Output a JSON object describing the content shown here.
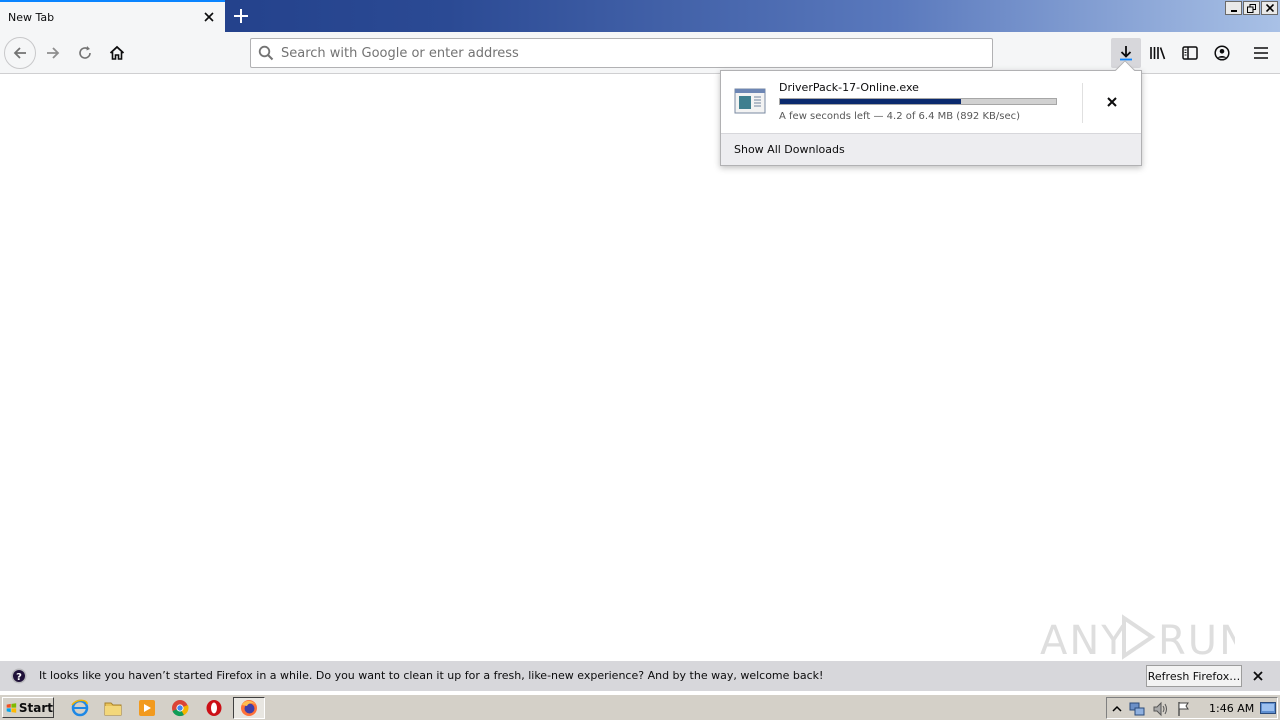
{
  "tab": {
    "title": "New Tab"
  },
  "urlbar": {
    "placeholder": "Search with Google or enter address",
    "value": ""
  },
  "download": {
    "filename": "DriverPack-17-Online.exe",
    "status": "A few seconds left — 4.2 of 6.4 MB (892 KB/sec)",
    "progress_fraction": 0.656,
    "show_all_label": "Show All Downloads"
  },
  "notification": {
    "text": "It looks like you haven’t started Firefox in a while. Do you want to clean it up for a fresh, like-new experience? And by the way, welcome back!",
    "button_label": "Refresh Firefox…"
  },
  "taskbar": {
    "start_label": "Start",
    "clock": "1:46 AM"
  },
  "watermark": {
    "text": "ANY RUN"
  },
  "colors": {
    "accent": "#0a84ff",
    "progress": "#0b2a6e",
    "toolbar": "#f5f6f7",
    "notification": "#d7d7db"
  },
  "icons": {
    "tab_close": "close-icon",
    "new_tab": "plus-icon",
    "back": "arrow-left-icon",
    "forward": "arrow-right-icon",
    "reload": "reload-icon",
    "home": "home-icon",
    "search": "search-icon",
    "downloads": "download-icon",
    "library": "library-icon",
    "sidebar": "sidebar-icon",
    "account": "account-icon",
    "menu": "hamburger-menu-icon"
  }
}
